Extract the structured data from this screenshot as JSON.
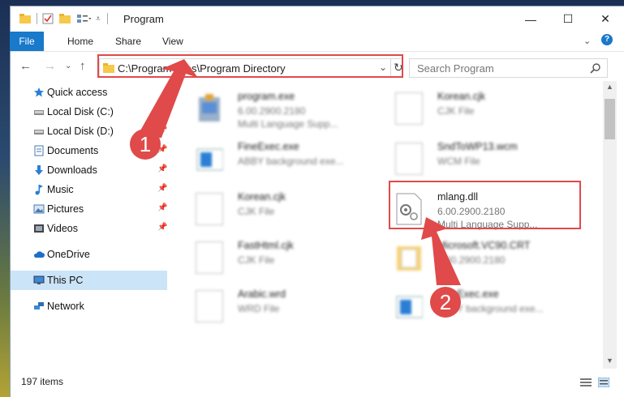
{
  "window": {
    "title": "Program",
    "controls": {
      "minimize": "—",
      "maximize": "☐",
      "close": "✕"
    }
  },
  "ribbon": {
    "tabs": [
      "File",
      "Home",
      "Share",
      "View"
    ]
  },
  "address": {
    "path": "C:\\Program Files\\Program Directory",
    "search_placeholder": "Search Program"
  },
  "sidebar": {
    "items": [
      {
        "label": "Quick access",
        "icon": "star-icon",
        "pinned": false
      },
      {
        "label": "Local Disk (C:)",
        "icon": "drive-icon",
        "pinned": false
      },
      {
        "label": "Local Disk (D:)",
        "icon": "drive-icon",
        "pinned": true
      },
      {
        "label": "Documents",
        "icon": "documents-icon",
        "pinned": true
      },
      {
        "label": "Downloads",
        "icon": "download-icon",
        "pinned": true
      },
      {
        "label": "Music",
        "icon": "music-icon",
        "pinned": true
      },
      {
        "label": "Pictures",
        "icon": "pictures-icon",
        "pinned": true
      },
      {
        "label": "Videos",
        "icon": "videos-icon",
        "pinned": true
      },
      {
        "label": "OneDrive",
        "icon": "cloud-icon",
        "pinned": false
      },
      {
        "label": "This PC",
        "icon": "monitor-icon",
        "pinned": false,
        "selected": true
      },
      {
        "label": "Network",
        "icon": "network-icon",
        "pinned": false
      }
    ]
  },
  "files": {
    "col1": [
      {
        "name": "program.exe",
        "line2": "6.00.2900.2180",
        "line3": "Multi Language Supp...",
        "icon": "exe-icon"
      },
      {
        "name": "FineExec.exe",
        "line2": "ABBY background exe...",
        "line3": "",
        "icon": "exe-icon"
      },
      {
        "name": "Korean.cjk",
        "line2": "CJK File",
        "line3": "",
        "icon": "file-icon"
      },
      {
        "name": "FastHtml.cjk",
        "line2": "CJK File",
        "line3": "",
        "icon": "file-icon"
      },
      {
        "name": "Arabic.wrd",
        "line2": "WRD File",
        "line3": "",
        "icon": "file-icon"
      }
    ],
    "col2": [
      {
        "name": "Korean.cjk",
        "line2": "CJK File",
        "line3": "",
        "icon": "file-icon"
      },
      {
        "name": "SndToWP13.wcm",
        "line2": "WCM File",
        "line3": "",
        "icon": "file-icon"
      },
      {
        "name": "mlang.dll",
        "line2": "6.00.2900.2180",
        "line3": "Multi Language Supp...",
        "icon": "dll-gear-icon",
        "highlighted": true
      },
      {
        "name": "Microsoft.VC90.CRT",
        "line2": "6.00.2900.2180",
        "line3": "",
        "icon": "folder-icon"
      },
      {
        "name": "FineExec.exe",
        "line2": "ABBY background exe...",
        "line3": "",
        "icon": "exe-icon"
      }
    ]
  },
  "annotations": {
    "step1": "1",
    "step2": "2"
  },
  "status": {
    "count": "197 items"
  },
  "colors": {
    "accent": "#1979ca",
    "highlight": "#e04a4a",
    "selected": "#cce4f7"
  }
}
